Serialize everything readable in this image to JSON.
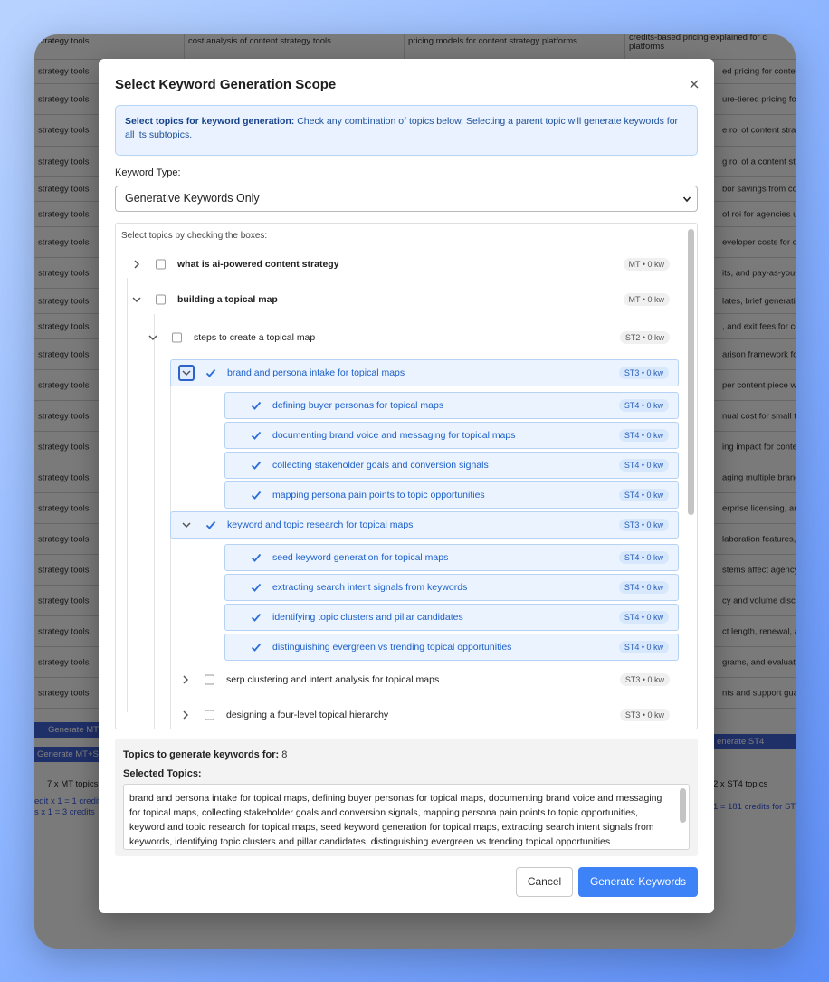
{
  "background": {
    "top_cells": [
      "strategy tools",
      "cost analysis of content strategy tools",
      "pricing models for content strategy platforms",
      "credits-based pricing explained for c",
      "platforms"
    ],
    "row_left_text": "strategy tools",
    "right_cells": [
      "ed pricing for conter",
      "ure-tiered pricing for",
      "e roi of content strat",
      "g roi of a content stra",
      "bor savings from cor",
      "of roi for agencies usi",
      "eveloper costs for co",
      "its, and pay-as-you-g",
      "lates, brief generatio",
      ", and exit fees for co",
      "arison framework for",
      "per content piece wit",
      "nual cost for small te",
      "ing impact for conter",
      "aging multiple brands",
      "erprise licensing, and",
      "laboration features, a",
      "stems affect agency i",
      "cy and volume disco",
      "ct length, renewal, an",
      "grams, and evaluating",
      "nts and support guar"
    ],
    "btn_left_1": "Generate MT",
    "btn_left_2": "Generate MT+S",
    "btn_right": "enerate ST4",
    "summary_left": "7 x MT topics",
    "summary_right": "2 x ST4 topics",
    "credit_left_1": "edit x 1 = 1 credit",
    "credit_left_2": "s x 1 = 3 credits",
    "credit_right": "1 = 181 credits for ST4"
  },
  "modal": {
    "title": "Select Keyword Generation Scope",
    "info_bold": "Select topics for keyword generation:",
    "info_text": " Check any combination of topics below. Selecting a parent topic will generate keywords for all its subtopics.",
    "keyword_type_label": "Keyword Type:",
    "keyword_type_value": "Generative Keywords Only",
    "tree_hint": "Select topics by checking the boxes:",
    "tree": [
      {
        "label": "what is ai-powered content strategy",
        "badge": "MT • 0 kw"
      },
      {
        "label": "building a topical map",
        "badge": "MT • 0 kw"
      },
      {
        "label": "steps to create a topical map",
        "badge": "ST2 • 0 kw"
      },
      {
        "label": "brand and persona intake for topical maps",
        "badge": "ST3 • 0 kw"
      },
      {
        "label": "defining buyer personas for topical maps",
        "badge": "ST4 • 0 kw"
      },
      {
        "label": "documenting brand voice and messaging for topical maps",
        "badge": "ST4 • 0 kw"
      },
      {
        "label": "collecting stakeholder goals and conversion signals",
        "badge": "ST4 • 0 kw"
      },
      {
        "label": "mapping persona pain points to topic opportunities",
        "badge": "ST4 • 0 kw"
      },
      {
        "label": "keyword and topic research for topical maps",
        "badge": "ST3 • 0 kw"
      },
      {
        "label": "seed keyword generation for topical maps",
        "badge": "ST4 • 0 kw"
      },
      {
        "label": "extracting search intent signals from keywords",
        "badge": "ST4 • 0 kw"
      },
      {
        "label": "identifying topic clusters and pillar candidates",
        "badge": "ST4 • 0 kw"
      },
      {
        "label": "distinguishing evergreen vs trending topical opportunities",
        "badge": "ST4 • 0 kw"
      },
      {
        "label": "serp clustering and intent analysis for topical maps",
        "badge": "ST3 • 0 kw"
      },
      {
        "label": "designing a four-level topical hierarchy",
        "badge": "ST3 • 0 kw"
      }
    ],
    "count_label": "Topics to generate keywords for:",
    "count_value": "8",
    "selected_label": "Selected Topics:",
    "selected_text": "brand and persona intake for topical maps, defining buyer personas for topical maps, documenting brand voice and messaging for topical maps, collecting stakeholder goals and conversion signals, mapping persona pain points to topic opportunities, keyword and topic research for topical maps, seed keyword generation for topical maps, extracting search intent signals from keywords, identifying topic clusters and pillar candidates, distinguishing evergreen vs trending topical opportunities",
    "cancel_label": "Cancel",
    "generate_label": "Generate Keywords"
  },
  "colors": {
    "accent": "#3d82f6",
    "selected_bg": "#eaf3fe",
    "selected_text": "#1d5fc8"
  }
}
